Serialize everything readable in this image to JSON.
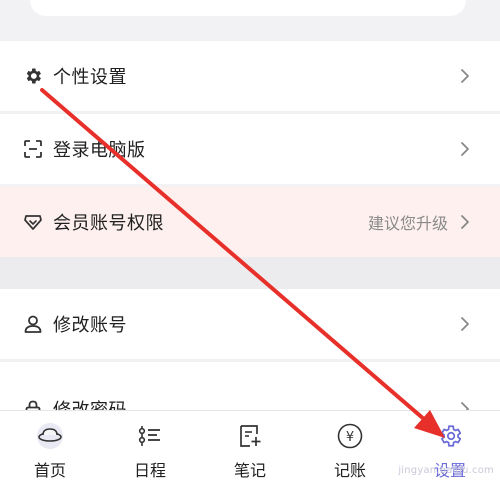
{
  "settings": {
    "items": [
      {
        "label": "个性设置",
        "icon": "gear-icon",
        "hint": ""
      },
      {
        "label": "登录电脑版",
        "icon": "scan-icon",
        "hint": ""
      },
      {
        "label": "会员账号权限",
        "icon": "diamond-icon",
        "hint": "建议您升级"
      },
      {
        "label": "修改账号",
        "icon": "user-icon",
        "hint": ""
      },
      {
        "label": "修改密码",
        "icon": "lock-icon",
        "hint": ""
      }
    ]
  },
  "tabbar": {
    "tabs": [
      {
        "label": "首页",
        "icon": "planet-icon"
      },
      {
        "label": "日程",
        "icon": "schedule-list-icon"
      },
      {
        "label": "笔记",
        "icon": "note-add-icon"
      },
      {
        "label": "记账",
        "icon": "yuan-coin-icon"
      },
      {
        "label": "设置",
        "icon": "gear-icon",
        "active": true
      }
    ]
  },
  "watermark": "jingyan.baidu.com",
  "colors": {
    "accent": "#6a6ad8",
    "member_row_bg": "#fdf0ef",
    "annotation_arrow": "#e8302a",
    "page_bg": "#f2f2f4"
  }
}
